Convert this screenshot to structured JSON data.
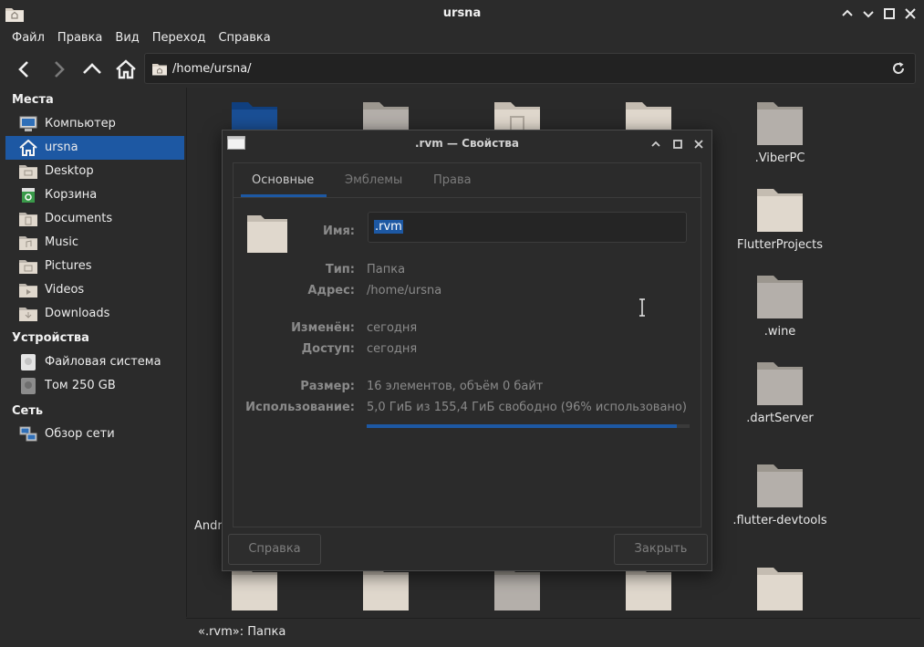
{
  "window": {
    "title": "ursna",
    "icon": "home-folder-icon"
  },
  "menubar": [
    "Файл",
    "Правка",
    "Вид",
    "Переход",
    "Справка"
  ],
  "location": {
    "path": "/home/ursna/"
  },
  "sidebar": {
    "places_title": "Места",
    "places": [
      {
        "label": "Компьютер",
        "icon": "computer-icon"
      },
      {
        "label": "ursna",
        "icon": "home-icon",
        "active": true
      },
      {
        "label": "Desktop",
        "icon": "desktop-folder-icon"
      },
      {
        "label": "Корзина",
        "icon": "trash-icon"
      },
      {
        "label": "Documents",
        "icon": "documents-folder-icon"
      },
      {
        "label": "Music",
        "icon": "music-folder-icon"
      },
      {
        "label": "Pictures",
        "icon": "pictures-folder-icon"
      },
      {
        "label": "Videos",
        "icon": "videos-folder-icon"
      },
      {
        "label": "Downloads",
        "icon": "downloads-folder-icon"
      }
    ],
    "devices_title": "Устройства",
    "devices": [
      {
        "label": "Файловая система",
        "icon": "drive-icon"
      },
      {
        "label": "Том 250 GB",
        "icon": "drive-icon"
      }
    ],
    "network_title": "Сеть",
    "network": [
      {
        "label": "Обзор сети",
        "icon": "network-icon"
      }
    ]
  },
  "files": {
    "visible_names": [
      ".ViberPC",
      "FlutterProjects",
      ".wine",
      ".dartServer",
      ".flutter-devtools",
      "Andr"
    ]
  },
  "status": {
    "text": "«.rvm»: Папка"
  },
  "dialog": {
    "title": ".rvm — Свойства",
    "tabs": [
      "Основные",
      "Эмблемы",
      "Права"
    ],
    "active_tab": "Основные",
    "name_label": "Имя:",
    "name_value": ".rvm",
    "type_label": "Тип:",
    "type_value": "Папка",
    "address_label": "Адрес:",
    "address_value": "/home/ursna",
    "modified_label": "Изменён:",
    "modified_value": "сегодня",
    "access_label": "Доступ:",
    "access_value": "сегодня",
    "size_label": "Размер:",
    "size_value": "16 элементов, объём 0 байт",
    "usage_label": "Использование:",
    "usage_value": "5,0 ГиБ из 155,4 ГиБ свободно (96% использовано)",
    "usage_percent": 96,
    "help_button": "Справка",
    "close_button": "Закрыть"
  },
  "colors": {
    "accent": "#1d58a3",
    "folder": "#e0d8cd",
    "folder_gray": "#b4afaa",
    "background": "#2b2b2b"
  }
}
